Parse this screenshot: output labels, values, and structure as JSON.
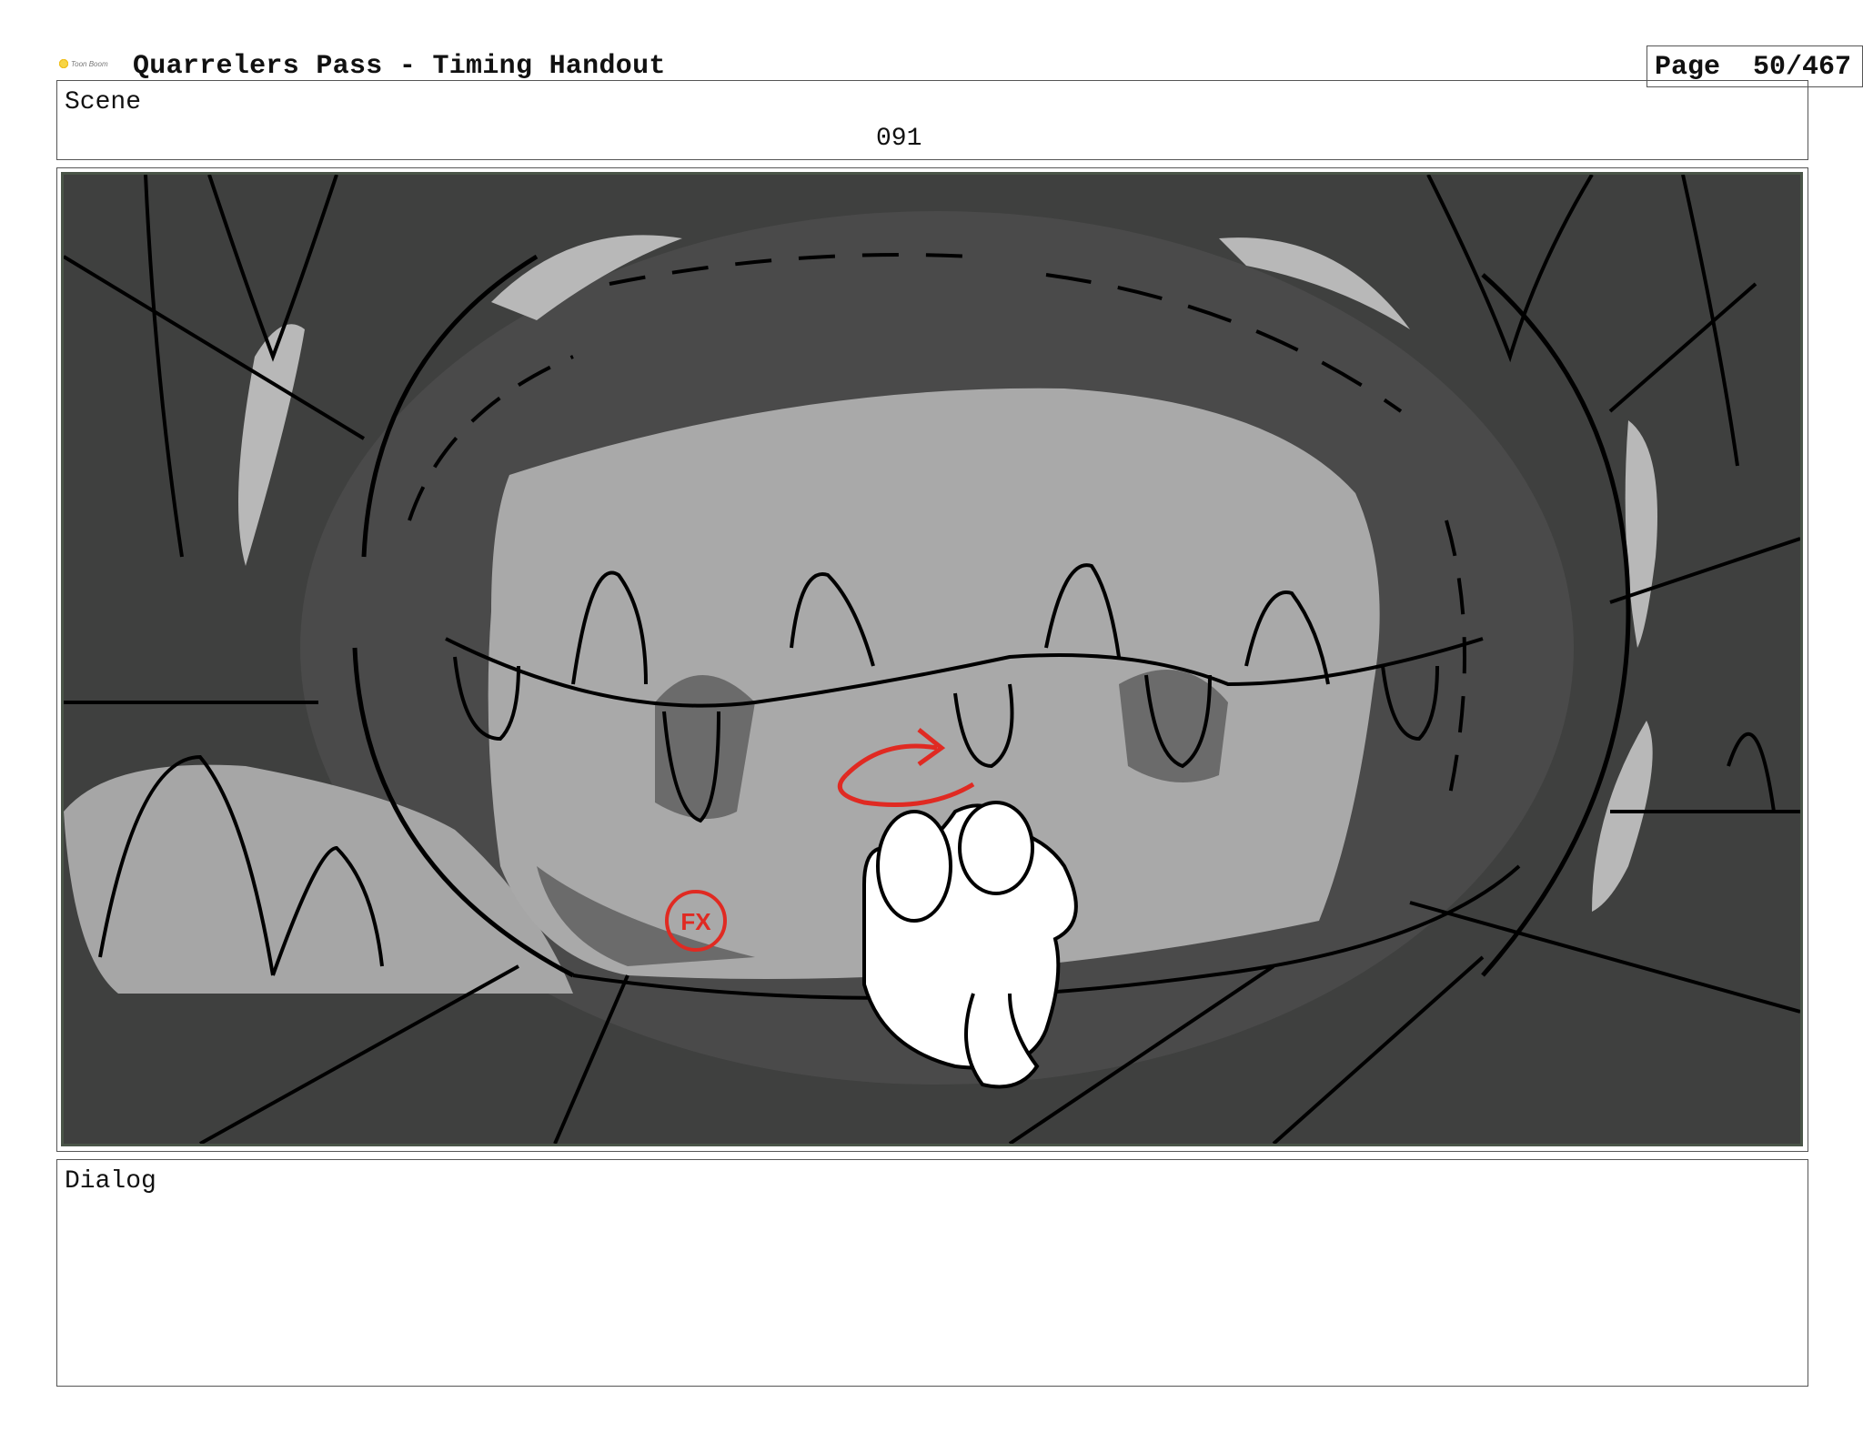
{
  "header": {
    "logo_text": "Toon Boom",
    "title": "Quarrelers Pass - Timing Handout",
    "page_label": "Page",
    "page_value": "50/467"
  },
  "scene": {
    "label": "Scene",
    "number": "091"
  },
  "panel": {
    "fx_mark": "FX",
    "colors": {
      "background": "#3f403f",
      "mouth": "#a9a9a9",
      "shadow": "#6b6b6b",
      "highlight": "#b8b8b8",
      "fx_red": "#e02a22",
      "character": "#ffffff"
    }
  },
  "dialog": {
    "label": "Dialog"
  }
}
